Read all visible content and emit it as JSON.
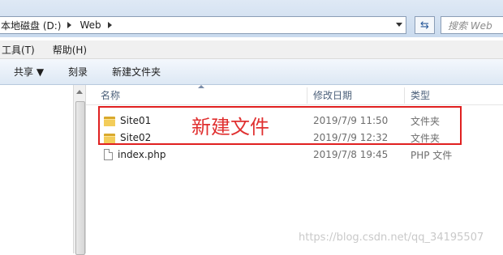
{
  "address_bar": {
    "crumbs": [
      "本地磁盘 (D:)",
      "Web"
    ],
    "search_placeholder": "搜索 Web"
  },
  "menu": [
    "工具(T)",
    "帮助(H)"
  ],
  "toolbar": {
    "share": "共享 ▼",
    "burn": "刻录",
    "new_folder": "新建文件夹"
  },
  "columns": {
    "name": "名称",
    "modified": "修改日期",
    "type": "类型"
  },
  "files": [
    {
      "name": "Site01",
      "modified": "2019/7/9 11:50",
      "type": "文件夹",
      "icon": "folder-icon"
    },
    {
      "name": "Site02",
      "modified": "2019/7/9 12:32",
      "type": "文件夹",
      "icon": "folder-icon"
    },
    {
      "name": "index.php",
      "modified": "2019/7/8 19:45",
      "type": "PHP 文件",
      "icon": "file-icon"
    }
  ],
  "annotation": {
    "text": "新建文件",
    "color": "#e02020"
  },
  "watermark": "https://blog.csdn.net/qq_34195507"
}
